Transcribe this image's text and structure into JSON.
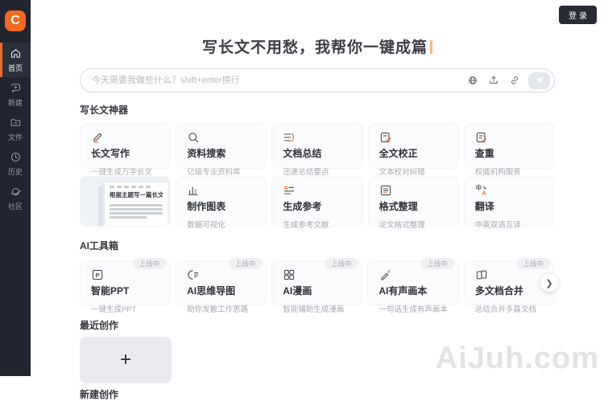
{
  "app": {
    "logo_letter": "C",
    "login_label": "登录"
  },
  "sidebar": {
    "items": [
      {
        "label": "首页",
        "icon": "home-icon",
        "active": true
      },
      {
        "label": "新建",
        "icon": "new-chat-icon",
        "active": false
      },
      {
        "label": "文件",
        "icon": "files-icon",
        "active": false
      },
      {
        "label": "历史",
        "icon": "history-icon",
        "active": false
      },
      {
        "label": "社区",
        "icon": "community-icon",
        "active": false
      }
    ]
  },
  "hero": {
    "title": "写长文不用愁，我帮你一键成篇"
  },
  "composer": {
    "placeholder": "今天需要我做些什么？shift+enter换行",
    "icons": [
      "globe-icon",
      "upload-icon",
      "link-icon",
      "send-icon"
    ]
  },
  "tools": {
    "title": "写长文神器",
    "cards": [
      {
        "title": "长文写作",
        "subtitle": "一键生成万字长文",
        "icon": "pencil-icon"
      },
      {
        "title": "资料搜索",
        "subtitle": "亿级专业资料库",
        "icon": "search-icon"
      },
      {
        "title": "文档总结",
        "subtitle": "迅速总结要点",
        "icon": "summary-icon"
      },
      {
        "title": "全文校正",
        "subtitle": "文本校对纠错",
        "icon": "proofread-icon"
      },
      {
        "title": "查重",
        "subtitle": "权威机构服务",
        "icon": "duplicate-check-icon"
      },
      {
        "title": "制作图表",
        "subtitle": "数据可视化",
        "icon": "chart-icon"
      },
      {
        "title": "生成参考",
        "subtitle": "生成参考文献",
        "icon": "reference-icon"
      },
      {
        "title": "格式整理",
        "subtitle": "论文格式整理",
        "icon": "format-icon"
      },
      {
        "title": "翻译",
        "subtitle": "中英双语互译",
        "icon": "translate-icon"
      }
    ],
    "preview": {
      "heading": "根据主题写一篇长文…"
    }
  },
  "toolbox": {
    "title": "AI工具箱",
    "badge": "上线中",
    "cards": [
      {
        "title": "智能PPT",
        "subtitle": "一键生成PPT",
        "icon": "ppt-icon"
      },
      {
        "title": "AI思维导图",
        "subtitle": "助你发散工作思路",
        "icon": "mindmap-icon"
      },
      {
        "title": "AI漫画",
        "subtitle": "智能辅助生成漫画",
        "icon": "comic-icon"
      },
      {
        "title": "AI有声画本",
        "subtitle": "一句话生成有声画本",
        "icon": "audiobook-icon"
      },
      {
        "title": "多文档合并",
        "subtitle": "总结合并多篇文档",
        "icon": "merge-docs-icon"
      }
    ]
  },
  "recent": {
    "title": "最近创作",
    "add_label": "+",
    "clipped_label": "新建创作"
  },
  "watermark": "AiJuh.com",
  "colors": {
    "accent": "#f2691f",
    "sidebar_bg": "#21252f",
    "badge_bg": "#eff0f3"
  }
}
